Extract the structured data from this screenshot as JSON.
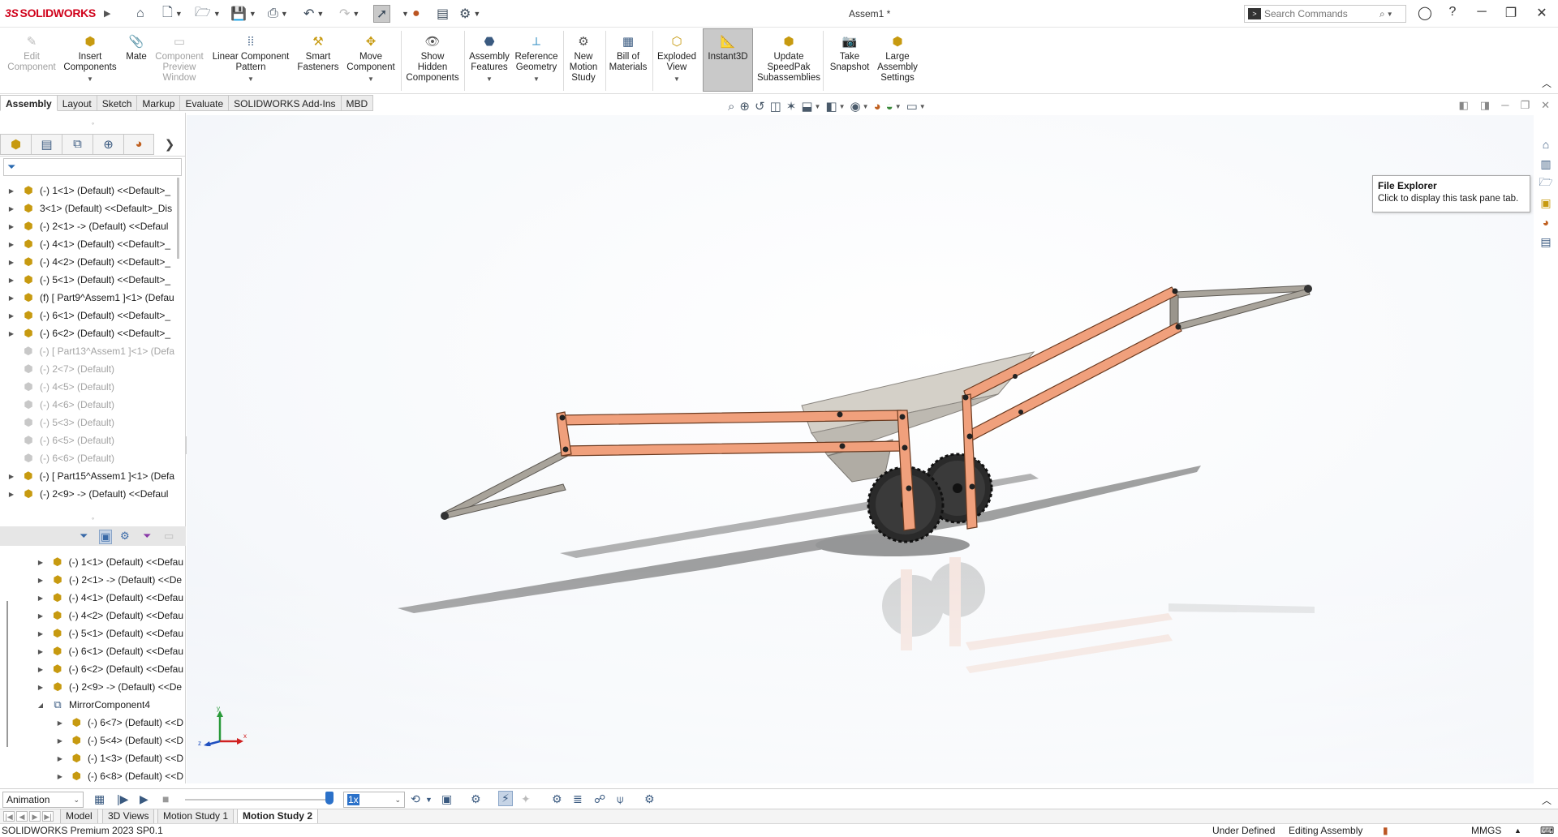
{
  "app": {
    "brand_ds": "3S",
    "brand_name": "SOLIDWORKS",
    "document_title": "Assem1 *"
  },
  "search": {
    "placeholder": "Search Commands"
  },
  "ribbon": {
    "edit_component": [
      "Edit",
      "Component"
    ],
    "insert_components": [
      "Insert",
      "Components"
    ],
    "mate": [
      "Mate"
    ],
    "component_preview": [
      "Component",
      "Preview",
      "Window"
    ],
    "linear_pattern": [
      "Linear Component",
      "Pattern"
    ],
    "smart_fasteners": [
      "Smart",
      "Fasteners"
    ],
    "move_component": [
      "Move",
      "Component"
    ],
    "show_hidden": [
      "Show",
      "Hidden",
      "Components"
    ],
    "assembly_features": [
      "Assembly",
      "Features"
    ],
    "reference_geometry": [
      "Reference",
      "Geometry"
    ],
    "new_motion_study": [
      "New",
      "Motion",
      "Study"
    ],
    "bill_of_materials": [
      "Bill of",
      "Materials"
    ],
    "exploded_view": [
      "Exploded",
      "View"
    ],
    "instant3d": [
      "Instant3D"
    ],
    "update_speedpak": [
      "Update",
      "SpeedPak",
      "Subassemblies"
    ],
    "take_snapshot": [
      "Take",
      "Snapshot"
    ],
    "large_assembly": [
      "Large",
      "Assembly",
      "Settings"
    ]
  },
  "tabs": [
    "Assembly",
    "Layout",
    "Sketch",
    "Markup",
    "Evaluate",
    "SOLIDWORKS Add-Ins",
    "MBD"
  ],
  "feature_tree": [
    {
      "label": "(-) 1<1> (Default) <<Default>_",
      "suppressed": false
    },
    {
      "label": "3<1> (Default) <<Default>_Dis",
      "suppressed": false
    },
    {
      "label": "(-) 2<1> -> (Default) <<Defaul",
      "suppressed": false
    },
    {
      "label": "(-) 4<1> (Default) <<Default>_",
      "suppressed": false
    },
    {
      "label": "(-) 4<2> (Default) <<Default>_",
      "suppressed": false
    },
    {
      "label": "(-) 5<1> (Default) <<Default>_",
      "suppressed": false
    },
    {
      "label": "(f) [ Part9^Assem1 ]<1> (Defau",
      "suppressed": false
    },
    {
      "label": "(-) 6<1> (Default) <<Default>_",
      "suppressed": false
    },
    {
      "label": "(-) 6<2> (Default) <<Default>_",
      "suppressed": false
    },
    {
      "label": "(-) [ Part13^Assem1 ]<1> (Defa",
      "suppressed": true
    },
    {
      "label": "(-) 2<7> (Default)",
      "suppressed": true
    },
    {
      "label": "(-) 4<5> (Default)",
      "suppressed": true
    },
    {
      "label": "(-) 4<6> (Default)",
      "suppressed": true
    },
    {
      "label": "(-) 5<3> (Default)",
      "suppressed": true
    },
    {
      "label": "(-) 6<5> (Default)",
      "suppressed": true
    },
    {
      "label": "(-) 6<6> (Default)",
      "suppressed": true
    },
    {
      "label": "(-) [ Part15^Assem1 ]<1> (Defa",
      "suppressed": false
    },
    {
      "label": "(-) 2<9> -> (Default) <<Defaul",
      "suppressed": false
    }
  ],
  "motion_tree": [
    {
      "label": "(-) 1<1> (Default) <<Defau",
      "indent": 0
    },
    {
      "label": "(-) 2<1> -> (Default) <<De",
      "indent": 0
    },
    {
      "label": "(-) 4<1> (Default) <<Defau",
      "indent": 0
    },
    {
      "label": "(-) 4<2> (Default) <<Defau",
      "indent": 0
    },
    {
      "label": "(-) 5<1> (Default) <<Defau",
      "indent": 0
    },
    {
      "label": "(-) 6<1> (Default) <<Defau",
      "indent": 0
    },
    {
      "label": "(-) 6<2> (Default) <<Defau",
      "indent": 0
    },
    {
      "label": "(-) 2<9> -> (Default) <<De",
      "indent": 0
    },
    {
      "label": "MirrorComponent4",
      "indent": 0
    },
    {
      "label": "(-) 6<7> (Default) <<D",
      "indent": 1
    },
    {
      "label": "(-) 5<4> (Default) <<D",
      "indent": 1
    },
    {
      "label": "(-) 1<3> (Default) <<D",
      "indent": 1
    },
    {
      "label": "(-) 6<8> (Default) <<D",
      "indent": 1
    }
  ],
  "triad": {
    "x": "x",
    "y": "y",
    "z": "z"
  },
  "tooltip": {
    "title": "File Explorer",
    "body": "Click to display this task pane tab."
  },
  "motion": {
    "study_type": "Animation",
    "speed": "1x"
  },
  "bottom_tabs": [
    "Model",
    "3D Views",
    "Motion Study 1",
    "Motion Study 2"
  ],
  "status": {
    "version": "SOLIDWORKS Premium 2023 SP0.1",
    "definition": "Under Defined",
    "mode": "Editing Assembly",
    "units": "MMGS"
  },
  "colors": {
    "accent_red": "#d0021b",
    "link_orange": "#f0a07c",
    "frame_gray": "#a8a39a",
    "select_blue": "#2b71c9"
  }
}
